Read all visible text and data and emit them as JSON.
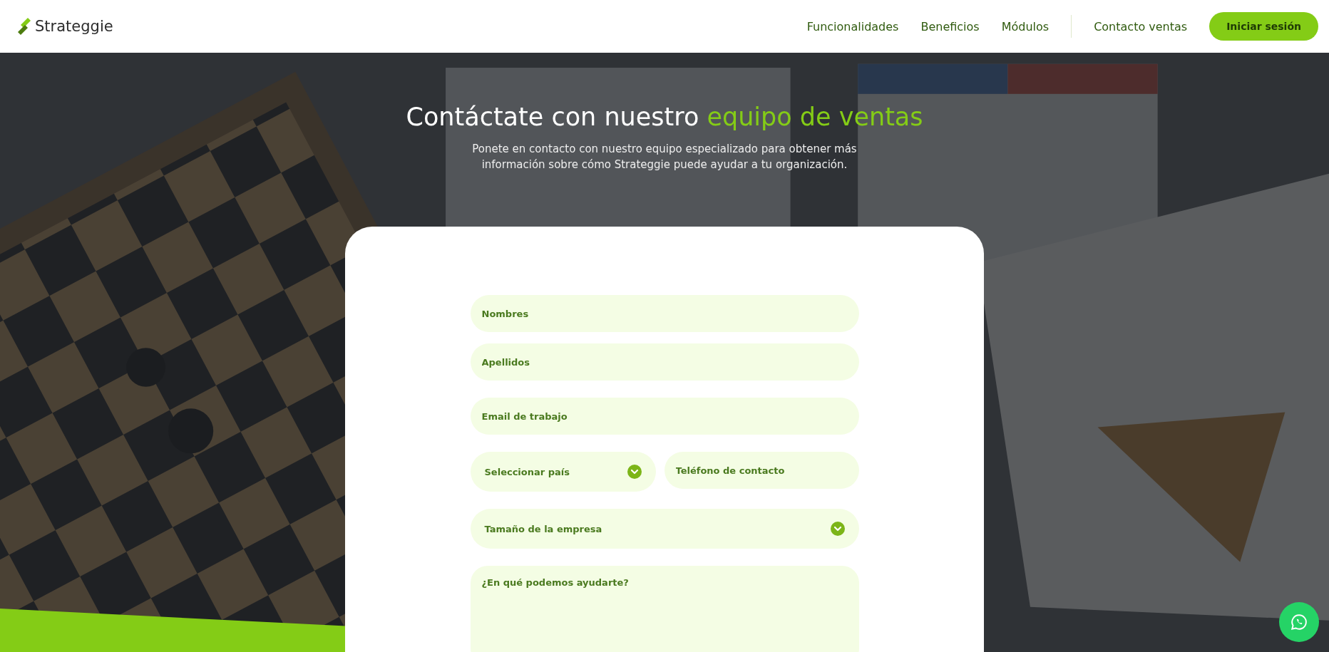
{
  "header": {
    "logo": "Strateggie",
    "nav": [
      {
        "label": "Funcionalidades"
      },
      {
        "label": "Beneficios"
      },
      {
        "label": "Módulos"
      }
    ],
    "contact_link": "Contacto ventas",
    "login_button": "Iniciar sesión"
  },
  "hero": {
    "title": "Contáctate con nuestro ",
    "title_highlight": "equipo de ventas",
    "subtitle": [
      "Ponete en contacto con nuestro equipo especializado para obtener más",
      "información sobre cómo Strateggie puede ayudar a tu organización."
    ]
  },
  "form": {
    "rows": [
      [
        {
          "kind": "input",
          "placeholder": "Nombres"
        }
      ],
      [
        {
          "kind": "input",
          "placeholder": "Apellidos"
        }
      ],
      [
        {
          "kind": "input",
          "placeholder": "Email de trabajo"
        }
      ],
      [
        {
          "kind": "select",
          "placeholder": "Seleccionar país"
        },
        {
          "kind": "input",
          "placeholder": "Teléfono de contacto"
        }
      ],
      [
        {
          "kind": "select",
          "placeholder": "Tamaño de la empresa"
        }
      ],
      [
        {
          "kind": "textarea",
          "placeholder": "¿En qué podemos ayudarte?"
        }
      ]
    ]
  }
}
